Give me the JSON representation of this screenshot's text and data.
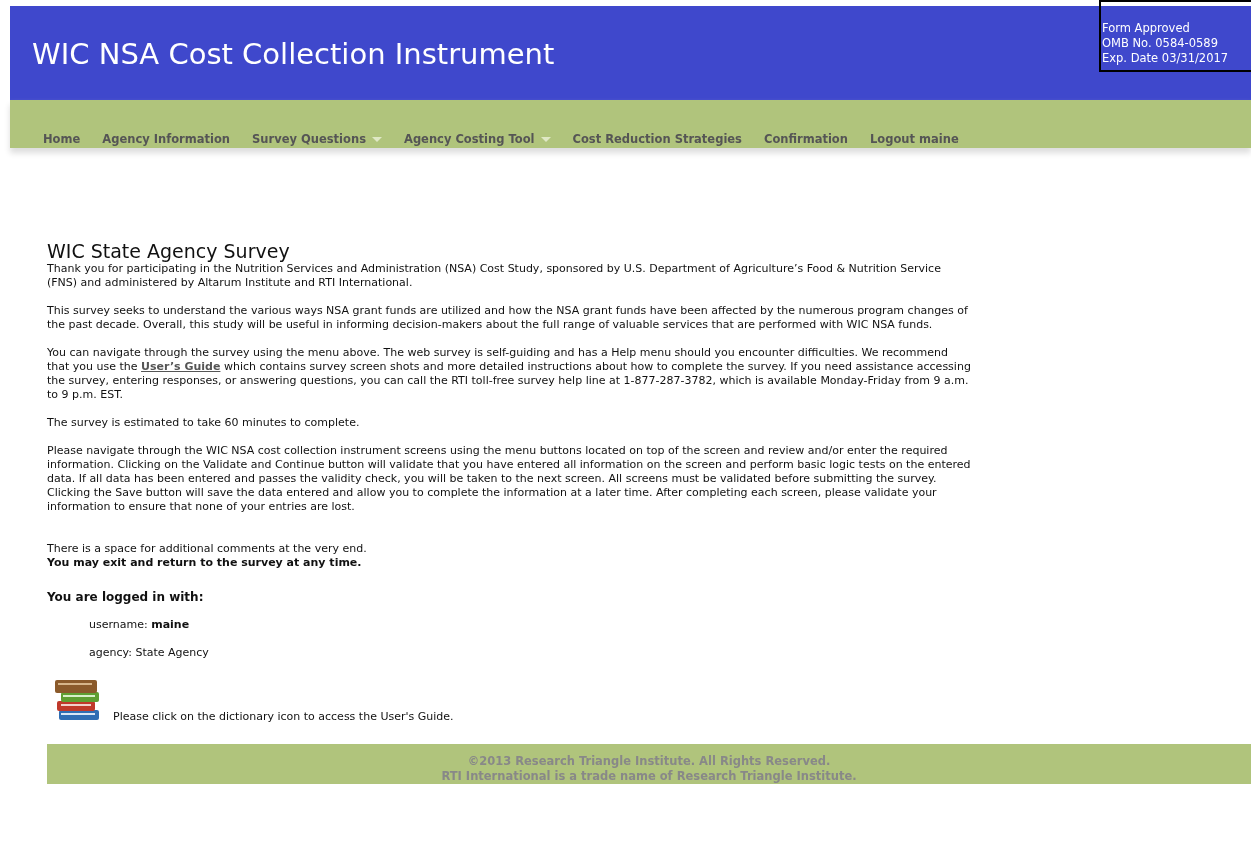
{
  "header": {
    "title": "WIC NSA Cost Collection Instrument",
    "approval": [
      "Form Approved",
      "OMB No. 0584-0589",
      "Exp. Date 03/31/2017"
    ]
  },
  "menu": [
    {
      "label": "Home",
      "dropdown": false
    },
    {
      "label": "Agency Information",
      "dropdown": false
    },
    {
      "label": "Survey Questions",
      "dropdown": true
    },
    {
      "label": "Agency Costing Tool",
      "dropdown": true
    },
    {
      "label": "Cost Reduction Strategies",
      "dropdown": false
    },
    {
      "label": "Confirmation",
      "dropdown": false
    },
    {
      "label": "Logout maine",
      "dropdown": false
    }
  ],
  "content": {
    "heading": "WIC State Agency Survey",
    "intro": "Thank you for participating in the Nutrition Services and Administration (NSA) Cost Study, sponsored by U.S. Department of Agriculture’s Food & Nutrition Service (FNS) and administered by Altarum Institute and RTI International.",
    "purpose": "This survey seeks to understand the various ways NSA grant funds are utilized and how the NSA grant funds have been affected by the numerous program changes of the past decade. Overall, this study will be useful in informing decision-makers about the full range of valuable services that are performed with WIC NSA funds.",
    "navigation": {
      "before": "You can navigate through the survey using the menu above. The web survey is self-guiding and has a Help menu should you encounter difficulties. We recommend that you use the",
      "link": "User’s Guide",
      "after": "which contains survey screen shots and more detailed instructions about how to complete the survey. If you need assistance accessing the survey, entering responses, or answering questions, you can call the RTI toll-free survey help line at 1-877-287-3782, which is available Monday-Friday from 9 a.m. to 9 p.m. EST."
    },
    "duration": "The survey is estimated to take 60 minutes to complete.",
    "instructions": "Please navigate through the WIC NSA cost collection instrument screens using the menu buttons located on top of the screen and review and/or enter the required information. Clicking on the Validate and Continue button will validate that you have entered all information on the screen and perform basic logic tests on the entered data. If all data has been entered and passes the validity check, you will be taken to the next screen. All screens must be validated before submitting the survey. Clicking the Save button will save the data entered and allow you to complete the information at a later time. After completing each screen, please validate your information to ensure that none of your entries are lost.",
    "comments": "There is a space for additional comments at the very end.",
    "exit_note": "You may exit and return to the survey at any time.",
    "login_heading": "You are logged in with:",
    "username": "username: **maine**",
    "agency": "agency: State Agency",
    "guide_hint": "Please click on the dictionary icon to access the User's Guide."
  },
  "footer": [
    "©2013 Research Triangle Institute. All Rights Reserved.",
    "RTI International is a trade name of Research Triangle Institute."
  ]
}
